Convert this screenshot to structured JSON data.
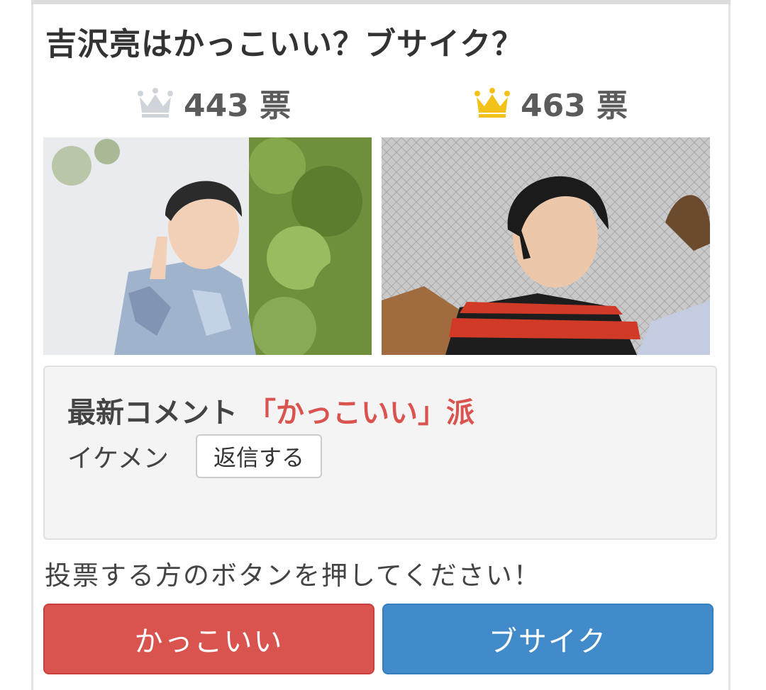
{
  "title": "吉沢亮はかっこいい？ブサイク？",
  "left_option": {
    "votes": "443 票",
    "crown": "silver-crown-icon",
    "photo_alt": "吉沢亮"
  },
  "right_option": {
    "votes": "463 票",
    "crown": "gold-crown-icon",
    "photo_alt": "吉沢亮"
  },
  "comment": {
    "heading": "最新コメント",
    "side": "「かっこいい」派",
    "text": "イケメン",
    "reply_label": "返信する"
  },
  "instruction": "投票する方のボタンを押してください！",
  "buttons": {
    "cool": "かっこいい",
    "ugly": "ブサイク"
  },
  "colors": {
    "accent_red": "#d9534f",
    "accent_blue": "#428bca",
    "crown_gold": "#f3c21a",
    "crown_silver": "#cfd4da"
  }
}
